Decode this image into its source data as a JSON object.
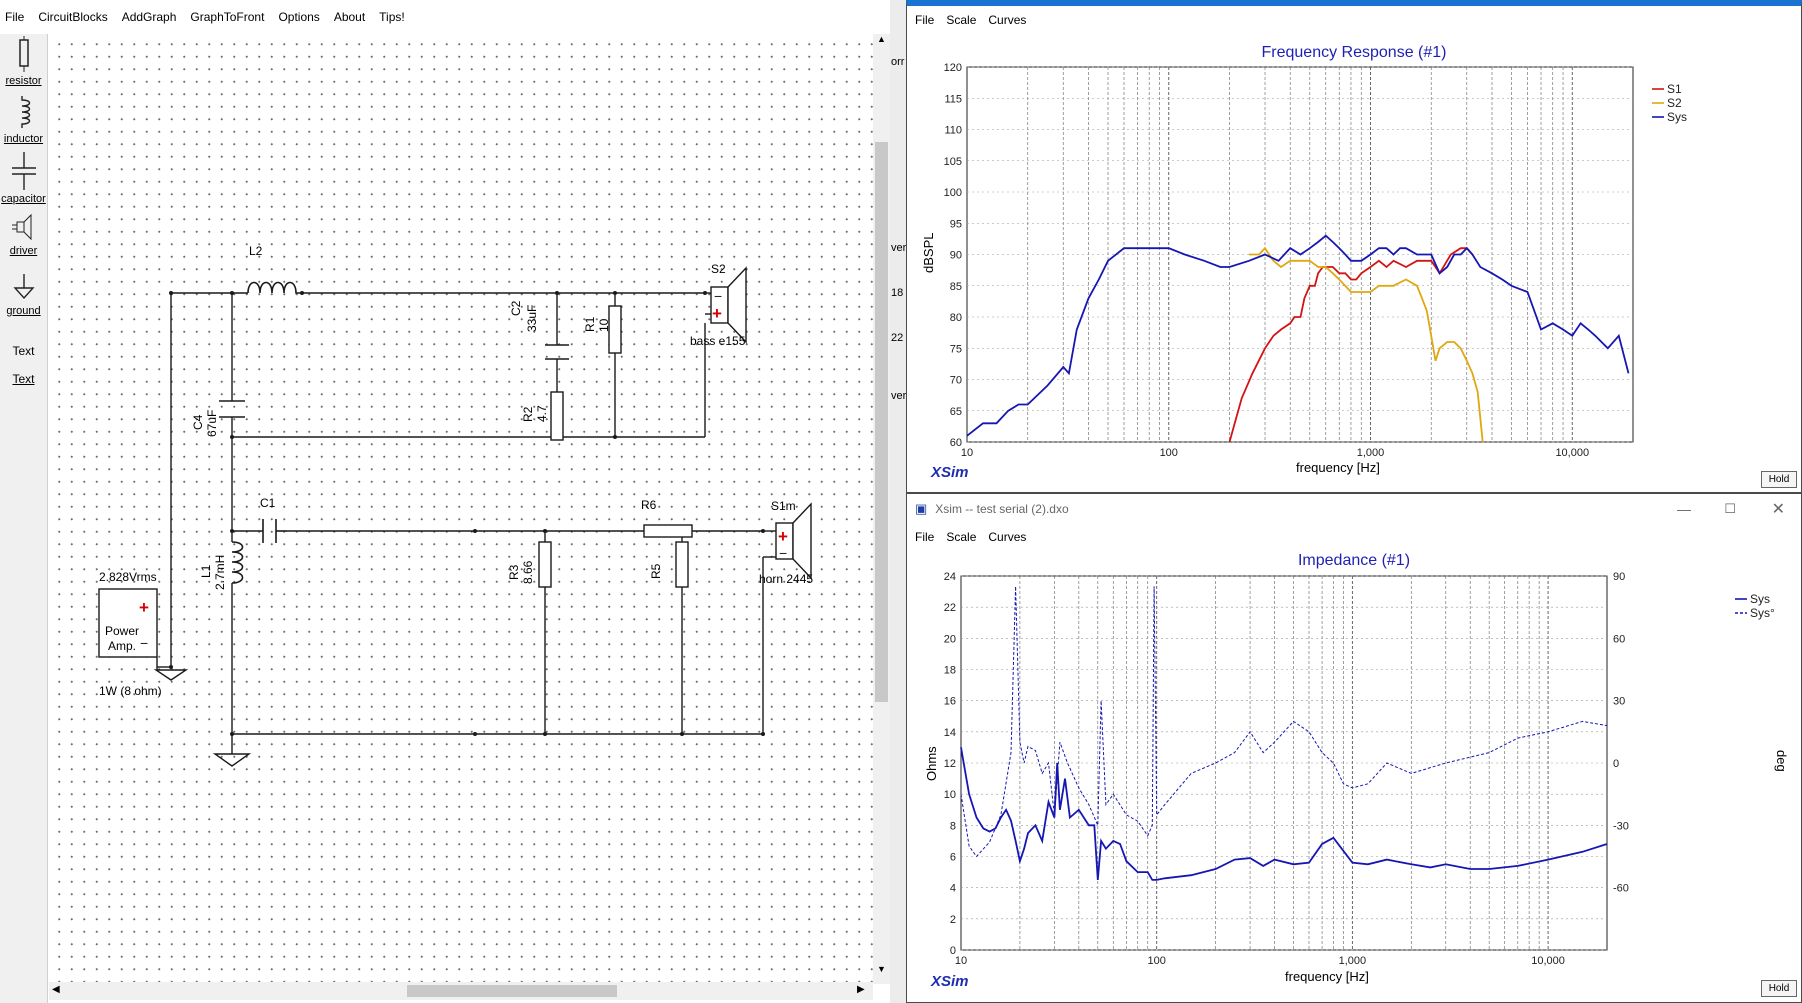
{
  "menu": [
    "File",
    "CircuitBlocks",
    "AddGraph",
    "GraphToFront",
    "Options",
    "About",
    "Tips!"
  ],
  "toolbox": [
    "resistor",
    "inductor",
    "capacitor",
    "driver",
    "ground",
    "Text",
    "Text"
  ],
  "circuit": {
    "L2": "L2",
    "C2": "C2",
    "C2v": "33uF",
    "R1": "R1",
    "R1v": "10",
    "R2": "R2",
    "R2v": "4.7",
    "C4": "C4",
    "C4v": "67uF",
    "S2": "S2",
    "S2v": "bass e155",
    "C1": "C1",
    "R6": "R6",
    "S1m": "S1m",
    "S1mv": "horn 2445",
    "L1": "L1",
    "L1v": "2.7mH",
    "R3": "R3",
    "R3v": "8.66",
    "R5": "R5",
    "amp_volts": "2.828Vrms",
    "amp_label1": "Power",
    "amp_label2": "Amp.",
    "amp_power": "1W (8 ohm)"
  },
  "behind_fragments": [
    "orr",
    "ver",
    "18",
    "22",
    "ver"
  ],
  "fr_window": {
    "menu": [
      "File",
      "Scale",
      "Curves"
    ],
    "title": "Frequency Response (#1)",
    "xlabel": "frequency [Hz]",
    "ylabel": "dBSPL",
    "xticks": [
      "10",
      "100",
      "1,000",
      "10,000"
    ],
    "yticks": [
      "60",
      "65",
      "70",
      "75",
      "80",
      "85",
      "90",
      "95",
      "100",
      "105",
      "110",
      "115",
      "120"
    ],
    "legend": [
      "S1",
      "S2",
      "Sys"
    ],
    "hold": "Hold",
    "brand": "XSim"
  },
  "imp_window": {
    "titlebar": "Xsim -- test serial (2).dxo",
    "menu": [
      "File",
      "Scale",
      "Curves"
    ],
    "title": "Impedance (#1)",
    "xlabel": "frequency [Hz]",
    "ylabel": "Ohms",
    "y2label": "deg",
    "xticks": [
      "10",
      "100",
      "1,000",
      "10,000"
    ],
    "yticks": [
      "0",
      "2",
      "4",
      "6",
      "8",
      "10",
      "12",
      "14",
      "16",
      "18",
      "20",
      "22",
      "24"
    ],
    "y2ticks": [
      "-60",
      "-30",
      "0",
      "30",
      "60",
      "90"
    ],
    "legend": [
      "Sys",
      "Sys°"
    ],
    "hold": "Hold",
    "brand": "XSim"
  },
  "chart_data": [
    {
      "type": "line",
      "title": "Frequency Response (#1)",
      "xlabel": "frequency [Hz]",
      "ylabel": "dBSPL",
      "xscale": "log",
      "xlim": [
        10,
        20000
      ],
      "ylim": [
        60,
        120
      ],
      "grid": true,
      "legend_position": "top-right",
      "series": [
        {
          "name": "S1",
          "color": "#d21414",
          "x": [
            200,
            230,
            260,
            300,
            330,
            360,
            400,
            420,
            450,
            470,
            500,
            530,
            550,
            580,
            600,
            650,
            700,
            750,
            800,
            850,
            900,
            1000,
            1100,
            1200,
            1300,
            1500,
            1700,
            1800,
            2000,
            2100,
            2200,
            2500,
            2800,
            3000,
            3200
          ],
          "y": [
            60,
            67,
            71,
            75,
            77,
            78,
            79,
            80,
            80,
            83,
            85,
            85,
            87,
            88,
            88,
            88,
            87,
            87,
            86,
            86,
            87,
            88,
            89,
            88,
            89,
            88,
            89,
            89,
            89,
            88,
            87,
            90,
            91,
            91,
            90
          ]
        },
        {
          "name": "S2",
          "color": "#e0a810",
          "x": [
            250,
            280,
            300,
            330,
            360,
            400,
            450,
            500,
            550,
            600,
            650,
            700,
            800,
            900,
            1000,
            1100,
            1300,
            1500,
            1700,
            1800,
            1900,
            2000,
            2100,
            2200,
            2400,
            2600,
            2800,
            3000,
            3200,
            3400,
            3600
          ],
          "y": [
            90,
            90,
            91,
            89,
            88,
            89,
            89,
            89,
            88,
            88,
            87,
            86,
            84,
            84,
            84,
            85,
            85,
            86,
            85,
            83,
            81,
            77,
            73,
            75,
            76,
            76,
            75,
            73,
            71,
            68,
            60
          ]
        },
        {
          "name": "Sys",
          "color": "#1616b4",
          "x": [
            10,
            12,
            14,
            16,
            18,
            20,
            25,
            30,
            32,
            35,
            40,
            45,
            50,
            60,
            70,
            80,
            100,
            120,
            150,
            180,
            200,
            250,
            300,
            350,
            400,
            450,
            500,
            550,
            600,
            650,
            700,
            750,
            800,
            900,
            1000,
            1100,
            1200,
            1300,
            1400,
            1500,
            1700,
            1800,
            2000,
            2200,
            2400,
            2600,
            2800,
            3000,
            3200,
            3500,
            4000,
            4500,
            5000,
            6000,
            7000,
            8000,
            9000,
            10000,
            11000,
            12000,
            13000,
            15000,
            17000,
            19000
          ],
          "y": [
            61,
            63,
            63,
            65,
            66,
            66,
            69,
            72,
            71,
            78,
            83,
            86,
            89,
            91,
            91,
            91,
            91,
            90,
            89,
            88,
            88,
            89,
            90,
            89,
            91,
            90,
            91,
            92,
            93,
            92,
            91,
            90,
            89,
            89,
            90,
            91,
            91,
            90,
            91,
            91,
            90,
            90,
            90,
            87,
            88,
            90,
            90,
            91,
            90,
            88,
            87,
            86,
            85,
            84,
            78,
            79,
            78,
            77,
            79,
            78,
            77,
            75,
            77,
            71
          ]
        }
      ]
    },
    {
      "type": "line",
      "title": "Impedance (#1)",
      "xlabel": "frequency [Hz]",
      "ylabel": "Ohms",
      "y2label": "deg",
      "xscale": "log",
      "xlim": [
        10,
        20000
      ],
      "ylim": [
        0,
        24
      ],
      "y2lim": [
        -90,
        90
      ],
      "grid": true,
      "legend_position": "top-right",
      "series": [
        {
          "name": "Sys",
          "axis": "left",
          "color": "#1616b4",
          "x": [
            10,
            11,
            12,
            13,
            14,
            15,
            16,
            17,
            18,
            19,
            20,
            21,
            22,
            24,
            26,
            28,
            30,
            31,
            32,
            34,
            36,
            40,
            45,
            48,
            50,
            52,
            55,
            60,
            65,
            70,
            80,
            90,
            95,
            100,
            110,
            150,
            200,
            250,
            300,
            350,
            400,
            500,
            600,
            700,
            800,
            1000,
            1200,
            1500,
            2000,
            2500,
            3000,
            4000,
            5000,
            7000,
            10000,
            15000,
            20000
          ],
          "y": [
            13,
            10,
            8.5,
            7.8,
            7.6,
            7.8,
            8.5,
            9,
            8.3,
            7,
            5.7,
            6.5,
            7.5,
            8,
            7,
            9.5,
            8.5,
            12,
            9,
            11,
            8.5,
            9,
            8,
            8,
            4.5,
            7,
            6.5,
            7,
            6.8,
            5.7,
            5,
            5,
            4.5,
            4.5,
            4.6,
            4.8,
            5.2,
            5.8,
            5.9,
            5.4,
            5.8,
            5.5,
            5.6,
            6.8,
            7.2,
            5.6,
            5.5,
            5.8,
            5.5,
            5.3,
            5.5,
            5.2,
            5.2,
            5.4,
            5.8,
            6.3,
            6.8
          ]
        },
        {
          "name": "Sys°",
          "axis": "right",
          "color": "#1616b4",
          "dashed": true,
          "x": [
            10,
            11,
            12,
            14,
            16,
            18,
            19,
            20,
            21,
            22,
            24,
            26,
            28,
            30,
            32,
            35,
            40,
            45,
            50,
            52,
            55,
            60,
            70,
            80,
            90,
            95,
            97,
            100,
            110,
            150,
            200,
            250,
            300,
            350,
            400,
            500,
            600,
            700,
            800,
            900,
            1000,
            1200,
            1500,
            2000,
            3000,
            5000,
            7000,
            10000,
            15000,
            20000
          ],
          "y": [
            -15,
            -40,
            -45,
            -38,
            -25,
            5,
            85,
            10,
            0,
            8,
            6,
            -5,
            0,
            -25,
            10,
            0,
            -12,
            -20,
            -30,
            30,
            -20,
            -15,
            -25,
            -28,
            -35,
            -30,
            85,
            -25,
            -20,
            -5,
            0,
            5,
            15,
            5,
            10,
            20,
            15,
            5,
            0,
            -10,
            -12,
            -10,
            0,
            -5,
            0,
            5,
            12,
            15,
            20,
            18
          ]
        }
      ]
    }
  ]
}
